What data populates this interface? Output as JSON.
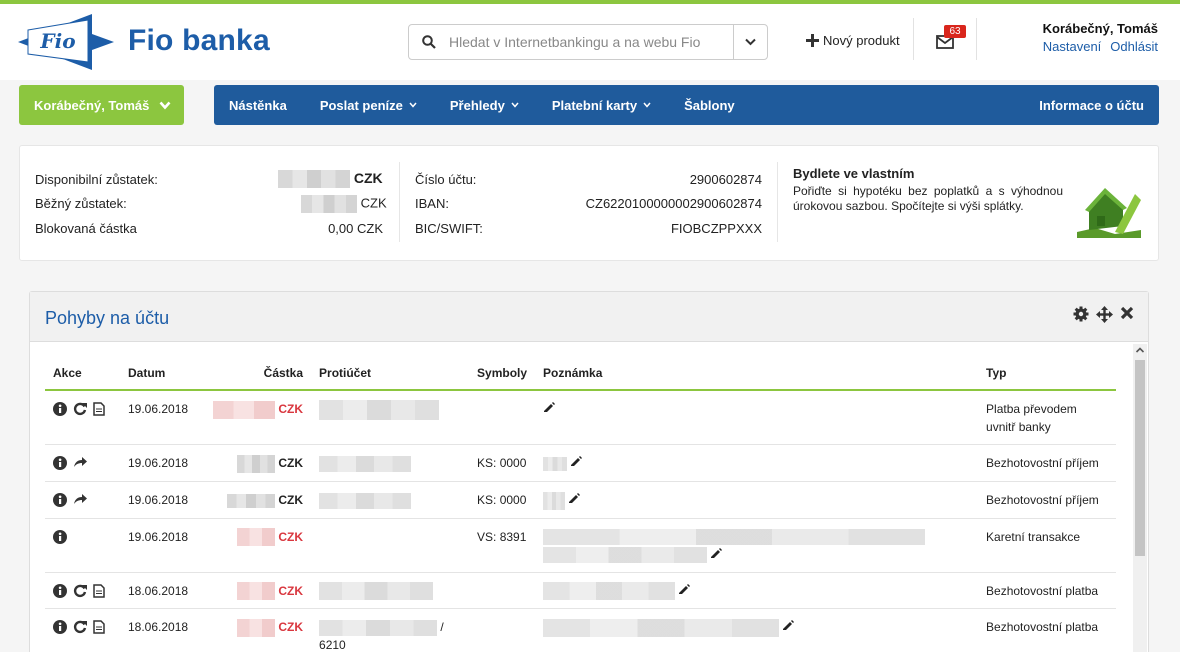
{
  "header": {
    "logo_text": "Fio",
    "brand": "Fio banka",
    "search_placeholder": "Hledat v Internetbankingu a na webu Fio",
    "new_product": "Nový produkt",
    "mail_count": "63",
    "user_name": "Korábečný, Tomáš",
    "settings_link": "Nastavení",
    "logout_link": "Odhlásit"
  },
  "account_button": "Korábečný, Tomáš",
  "nav": {
    "items": [
      "Nástěnka",
      "Poslat peníze",
      "Přehledy",
      "Platební karty",
      "Šablony"
    ],
    "right": "Informace o účtu"
  },
  "summary": {
    "available_label": "Disponibilní zůstatek:",
    "current_label": "Běžný zůstatek:",
    "blocked_label": "Blokovaná částka",
    "currency": "CZK",
    "blocked_value": "0,00 CZK",
    "account_label": "Číslo účtu:",
    "account_value": "2900602874",
    "iban_label": "IBAN:",
    "iban_value": "CZ6220100000002900602874",
    "bic_label": "BIC/SWIFT:",
    "bic_value": "FIOBCZPPXXX"
  },
  "promo": {
    "title": "Bydlete ve vlastním",
    "text": "Pořiďte si hypotéku bez poplatků a s výhodnou úrokovou sazbou. Spočítejte si výši splátky."
  },
  "panel": {
    "title": "Pohyby na účtu",
    "columns": [
      "Akce",
      "Datum",
      "Částka",
      "Protiúčet",
      "Symboly",
      "Poznámka",
      "Typ"
    ],
    "rows": [
      {
        "date": "19.06.2018",
        "currency": "CZK",
        "symbols": "",
        "type": "Platba převodem uvnitř banky",
        "counter_suffix": ""
      },
      {
        "date": "19.06.2018",
        "currency": "CZK",
        "symbols": "KS: 0000",
        "type": "Bezhotovostní příjem",
        "counter_suffix": ""
      },
      {
        "date": "19.06.2018",
        "currency": "CZK",
        "symbols": "KS: 0000",
        "type": "Bezhotovostní příjem",
        "counter_suffix": ""
      },
      {
        "date": "19.06.2018",
        "currency": "CZK",
        "symbols": "VS: 8391",
        "type": "Karetní transakce",
        "counter_suffix": ""
      },
      {
        "date": "18.06.2018",
        "currency": "CZK",
        "symbols": "",
        "type": "Bezhotovostní platba",
        "counter_suffix": ""
      },
      {
        "date": "18.06.2018",
        "currency": "CZK",
        "symbols": "",
        "type": "Bezhotovostní platba",
        "counter_suffix": "/",
        "counter_bank": "6210"
      }
    ]
  }
}
